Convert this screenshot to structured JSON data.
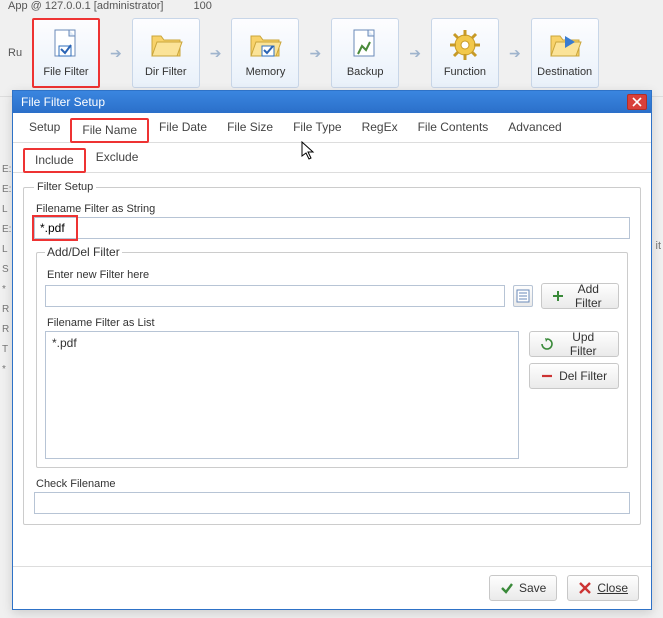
{
  "header": {
    "title_left": "App @ 127.0.0.1 [administrator]",
    "title_right": "100",
    "run_label": "Ru"
  },
  "ribbon": [
    {
      "key": "file-filter",
      "label": "File Filter"
    },
    {
      "key": "dir-filter",
      "label": "Dir Filter"
    },
    {
      "key": "memory",
      "label": "Memory"
    },
    {
      "key": "backup",
      "label": "Backup"
    },
    {
      "key": "function",
      "label": "Function"
    },
    {
      "key": "destination",
      "label": "Destination"
    }
  ],
  "side_letters": [
    "E:",
    "E:",
    "L",
    "",
    "E:",
    "L",
    "S",
    "*",
    "R",
    "R",
    "T",
    "",
    "*"
  ],
  "side_right": "it",
  "dialog": {
    "title": "File Filter Setup",
    "tabs": [
      "Setup",
      "File Name",
      "File Date",
      "File Size",
      "File Type",
      "RegEx",
      "File Contents",
      "Advanced"
    ],
    "active_tab": 1,
    "subtabs": [
      "Include",
      "Exclude"
    ],
    "active_subtab": 0,
    "fs_legend": "Filter Setup",
    "filter_string_label": "Filename Filter as String",
    "filter_string_value": "*.pdf",
    "adddel_legend": "Add/Del Filter",
    "enter_filter_label": "Enter new Filter here",
    "enter_filter_value": "",
    "add_filter_btn": "Add Filter",
    "list_label": "Filename Filter as List",
    "list_items": [
      "*.pdf"
    ],
    "upd_filter_btn": "Upd Filter",
    "del_filter_btn": "Del Filter",
    "check_filename_label": "Check Filename",
    "check_filename_value": "",
    "save_btn": "Save",
    "close_btn": "Close"
  }
}
